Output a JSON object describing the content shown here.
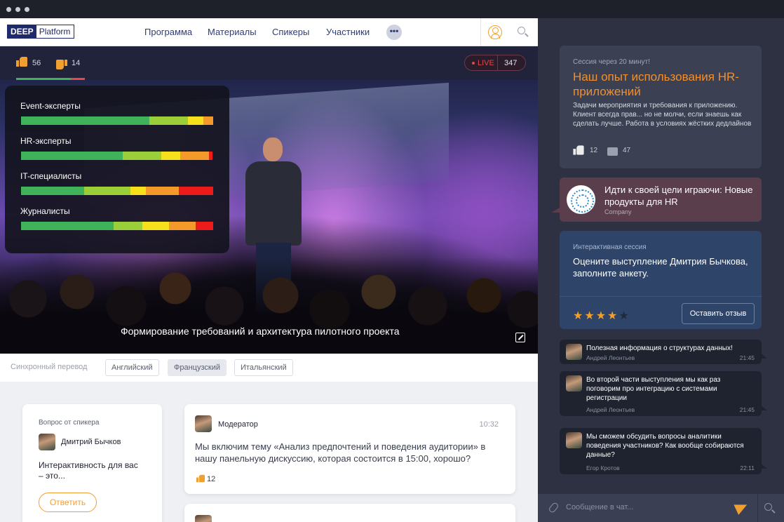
{
  "brand": {
    "part1": "DEEP",
    "part2": "Platform"
  },
  "nav": {
    "items": [
      "Программа",
      "Материалы",
      "Спикеры",
      "Участники"
    ],
    "more_label": "•••",
    "icons": [
      "user-icon",
      "search-icon"
    ]
  },
  "video": {
    "likes": "56",
    "dislikes": "14",
    "like_ratio": 0.8,
    "live_label": "LIVE",
    "viewers": "347",
    "subtitle": "Формирование требований и архитектура пилотного проекта",
    "poll": [
      {
        "label": "Event-эксперты",
        "segments": [
          0.67,
          0.2,
          0.08,
          0.05,
          0.0
        ]
      },
      {
        "label": "HR-эксперты",
        "segments": [
          0.53,
          0.2,
          0.1,
          0.15,
          0.02
        ]
      },
      {
        "label": "IT-специалисты",
        "segments": [
          0.33,
          0.24,
          0.08,
          0.17,
          0.18
        ]
      },
      {
        "label": "Журналисты",
        "segments": [
          0.48,
          0.15,
          0.14,
          0.14,
          0.09
        ]
      }
    ],
    "poll_colors": [
      "#3fb25a",
      "#9bcf3a",
      "#f6e01c",
      "#f39a2a",
      "#ee1b1b"
    ]
  },
  "translation": {
    "label": "Синхронный перевод",
    "languages": [
      "Английский",
      "Французский",
      "Итальянский"
    ],
    "active": "Французский"
  },
  "speaker_question": {
    "label": "Вопрос от спикера",
    "speaker": "Дмитрий Бычков",
    "text": "Интерактивность для вас – это...",
    "answer_button": "Ответить"
  },
  "feed": [
    {
      "author": "Модератор",
      "time": "10:32",
      "text": "Мы включим тему «Анализ предпочтений и поведения аудитории» в нашу панельную дискуссию, которая состоится в 15:00, хорошо?",
      "likes": "12"
    }
  ],
  "sidebar": {
    "session": {
      "pre": "Сессия через 20 минут!",
      "title": "Наш опыт использования HR-приложений",
      "desc": "Задачи мероприятия и требования к приложению. Клиент всегда прав... но не молчи, если знаешь как сделать лучше. Работа в условиях жёстких дедлайнов",
      "likes": "12",
      "comments": "47"
    },
    "promo": {
      "title": "Идти к своей цели играючи: Новые продукты для HR",
      "company": "Company"
    },
    "interactive": {
      "pre": "Интерактивная сессия",
      "text": "Оцените выступление Дмитрия Бычкова, заполните анкету.",
      "rating": 4,
      "max_rating": 5,
      "button": "Оставить отзыв"
    },
    "chat": [
      {
        "text": "Полезная информация о структурах данных!",
        "author": "Андрей Леонтьев",
        "time": "21:45"
      },
      {
        "text": "Во второй части выступления мы как раз поговорим про интеграцию с системами регистрации",
        "author": "Андрей Леонтьев",
        "time": "21:45"
      },
      {
        "text": "Мы сможем обсудить вопросы аналитики поведения участников? Как вообще собираются данные?",
        "author": "Егор Кротов",
        "time": "22:11"
      }
    ],
    "input_placeholder": "Сообщение в чат..."
  },
  "colors": {
    "accent": "#f0a030",
    "brand_navy": "#1e2a6b",
    "live_red": "#e04a4a"
  }
}
